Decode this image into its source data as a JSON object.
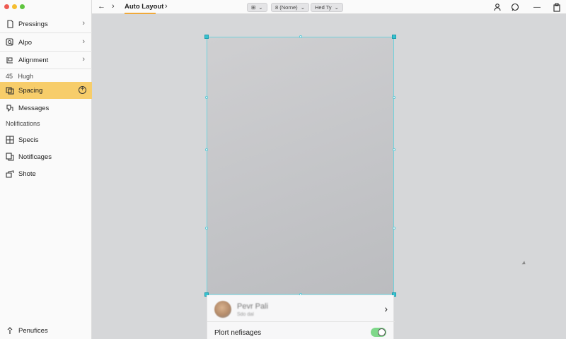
{
  "window": {
    "traffic_colors": [
      "#ee5a52",
      "#f5bd2f",
      "#5fc53f"
    ]
  },
  "sidebar": {
    "items": [
      {
        "label": "Pressings",
        "icon": "document-icon",
        "chevron": "›"
      },
      {
        "label": "Alpo",
        "icon": "search-icon",
        "chevron": "›"
      },
      {
        "label": "Alignment",
        "icon": "align-icon",
        "chevron": "›"
      }
    ],
    "height_label": {
      "number": "45",
      "label": "Hugh"
    },
    "active_item": {
      "label": "Spacing",
      "icon": "spacing-icon",
      "action": "+"
    },
    "messages": {
      "label": "Messages",
      "icon": "chat-icon"
    },
    "notifications_heading": "Nolifications",
    "sub_items": [
      {
        "label": "Specis",
        "icon": "grid-icon"
      },
      {
        "label": "Notificages",
        "icon": "copy-icon"
      },
      {
        "label": "Shote",
        "icon": "share-icon"
      }
    ],
    "footer": {
      "label": "Penufices",
      "icon": "pin-icon"
    }
  },
  "toolbar": {
    "back": "←",
    "forward": "›",
    "tab_title": "Auto Layout",
    "tab_chevron": "›",
    "pills": [
      {
        "label": "⊞",
        "caret": "⌄"
      },
      {
        "label": "8 (Norne)",
        "caret": "⌄"
      },
      {
        "label": "Hed Ty",
        "caret": "⌄"
      }
    ],
    "right_icons": [
      "user-icon",
      "comment-icon",
      "minus-icon",
      "clipboard-icon"
    ],
    "minus": "—"
  },
  "canvas": {
    "profile": {
      "name": "Pevr Pali",
      "sub": "Sdo dal",
      "chevron": "›"
    },
    "toggle": {
      "label": "Plort nefisages",
      "state": "on"
    },
    "accent_color": "#38c1cf"
  }
}
